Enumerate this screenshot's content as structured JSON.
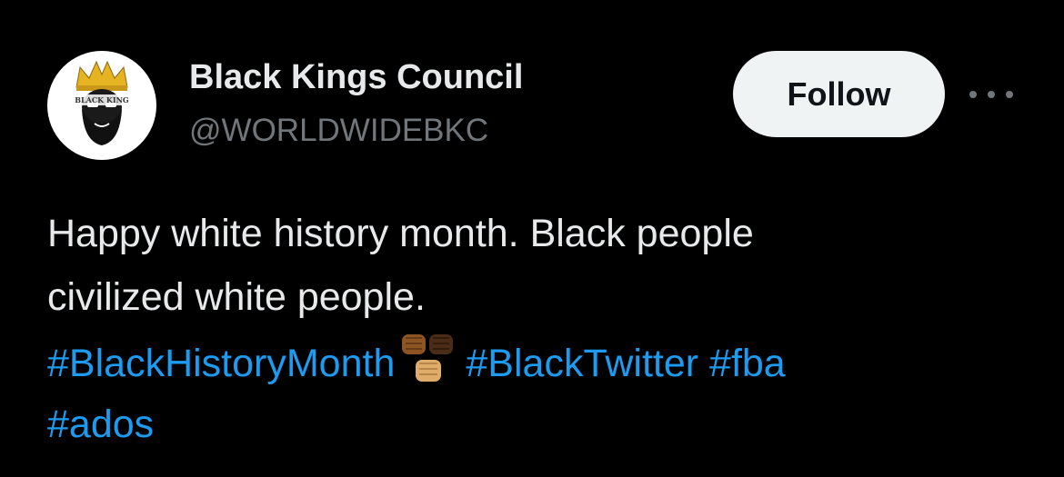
{
  "author": {
    "display_name": "Black Kings Council",
    "handle": "@WORLDWIDEBKC",
    "avatar_logo_text": "BLACK KING"
  },
  "actions": {
    "follow_label": "Follow"
  },
  "tweet": {
    "line1": "Happy white history month. Black people",
    "line2": "civilized white people.",
    "hashtags": {
      "black_history_month": "#BlackHistoryMonth",
      "black_twitter": "#BlackTwitter",
      "fba": "#fba",
      "ados": "#ados"
    },
    "emoji": "raised-fists-icon"
  },
  "colors": {
    "background": "#000000",
    "primary_text": "#e7e9ea",
    "secondary_text": "#71767b",
    "link": "#1d9bf0",
    "follow_button_bg": "#eff3f4",
    "follow_button_text": "#0f1419"
  }
}
